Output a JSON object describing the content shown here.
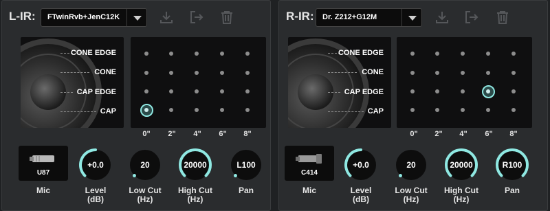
{
  "accent": "#8fe8e2",
  "panels": [
    {
      "title": "L-IR:",
      "ir_file": "FTwinRvb+JenC12K",
      "tools": [
        "download-icon",
        "export-icon",
        "trash-icon"
      ],
      "zones": [
        "CONE EDGE",
        "CONE",
        "CAP EDGE",
        "CAP"
      ],
      "grid_x_labels": [
        "0\"",
        "2\"",
        "4\"",
        "6\"",
        "8\""
      ],
      "selected_position": {
        "column": 0,
        "row": 3
      },
      "mic": {
        "name": "U87",
        "label": "Mic"
      },
      "knobs": [
        {
          "value": "+0.0",
          "label": "Level",
          "unit": "(dB)",
          "level": 0.5
        },
        {
          "value": "20",
          "label": "Low Cut",
          "unit": "(Hz)",
          "level": 0.0
        },
        {
          "value": "20000",
          "label": "High Cut",
          "unit": "(Hz)",
          "level": 1.0
        },
        {
          "value": "L100",
          "label": "Pan",
          "unit": "",
          "level": 0.0
        }
      ]
    },
    {
      "title": "R-IR:",
      "ir_file": "Dr. Z212+G12M",
      "tools": [
        "download-icon",
        "export-icon",
        "trash-icon"
      ],
      "zones": [
        "CONE EDGE",
        "CONE",
        "CAP EDGE",
        "CAP"
      ],
      "grid_x_labels": [
        "0\"",
        "2\"",
        "4\"",
        "6\"",
        "8\""
      ],
      "selected_position": {
        "column": 3,
        "row": 2
      },
      "mic": {
        "name": "C414",
        "label": "Mic"
      },
      "knobs": [
        {
          "value": "+0.0",
          "label": "Level",
          "unit": "(dB)",
          "level": 0.5
        },
        {
          "value": "20",
          "label": "Low Cut",
          "unit": "(Hz)",
          "level": 0.0
        },
        {
          "value": "20000",
          "label": "High Cut",
          "unit": "(Hz)",
          "level": 1.0
        },
        {
          "value": "R100",
          "label": "Pan",
          "unit": "",
          "level": 1.0
        }
      ]
    }
  ]
}
